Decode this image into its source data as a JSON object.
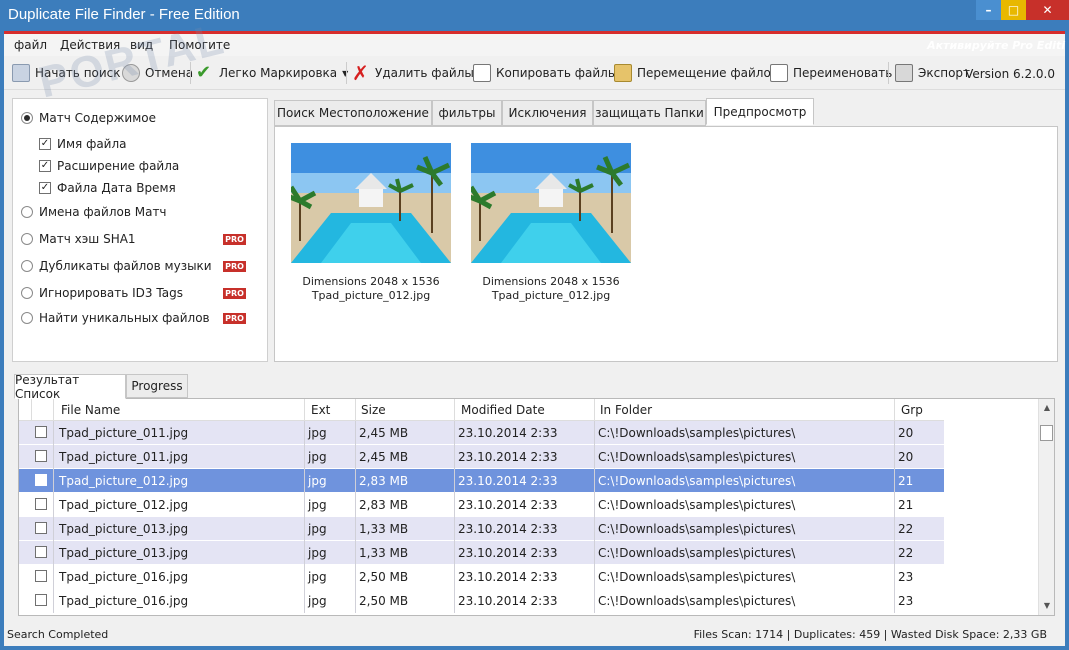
{
  "window": {
    "title": "Duplicate File Finder - Free Edition"
  },
  "menu": {
    "items": [
      "файл",
      "Действия",
      "вид",
      "Помогите"
    ],
    "activate": "Активируйте Pro Editi"
  },
  "toolbar": {
    "start": "Начать поиск",
    "cancel": "Отмена",
    "easy_mark": "Легко Маркировка",
    "delete": "Удалить файлы",
    "copy": "Копировать файлы",
    "move": "Перемещение файлов",
    "rename": "Переименовать",
    "export": "Экспорт",
    "version": "Version 6.2.0.0"
  },
  "options": {
    "match_content": "Матч Содержимое",
    "file_name": "Имя файла",
    "extension": "Расширение файла",
    "file_datetime": "Файла Дата Время",
    "match_names": "Имена файлов Матч",
    "sha1": "Матч хэш SHA1",
    "music": "Дубликаты файлов музыки",
    "id3": "Игнорировать ID3 Tags",
    "unique": "Найти уникальных файлов",
    "pro": "PRO"
  },
  "top_tabs": [
    "Поиск Местоположение",
    "фильтры",
    "Исключения",
    "защищать Папки",
    "Предпросмотр"
  ],
  "preview": [
    {
      "dim": "Dimensions 2048 x 1536",
      "name": "Tpad_picture_012.jpg"
    },
    {
      "dim": "Dimensions 2048 x 1536",
      "name": "Tpad_picture_012.jpg"
    }
  ],
  "bottom_tabs": [
    "Результат Список",
    "Progress"
  ],
  "grid": {
    "headers": [
      "File Name",
      "Ext",
      "Size",
      "Modified Date",
      "In Folder",
      "Grp"
    ],
    "rows": [
      {
        "name": "Tpad_picture_011.jpg",
        "ext": "jpg",
        "size": "2,45 MB",
        "date": "23.10.2014 2:33",
        "folder": "C:\\!Downloads\\samples\\pictures\\",
        "grp": "20"
      },
      {
        "name": "Tpad_picture_011.jpg",
        "ext": "jpg",
        "size": "2,45 MB",
        "date": "23.10.2014 2:33",
        "folder": "C:\\!Downloads\\samples\\pictures\\",
        "grp": "20"
      },
      {
        "name": "Tpad_picture_012.jpg",
        "ext": "jpg",
        "size": "2,83 MB",
        "date": "23.10.2014 2:33",
        "folder": "C:\\!Downloads\\samples\\pictures\\",
        "grp": "21"
      },
      {
        "name": "Tpad_picture_012.jpg",
        "ext": "jpg",
        "size": "2,83 MB",
        "date": "23.10.2014 2:33",
        "folder": "C:\\!Downloads\\samples\\pictures\\",
        "grp": "21"
      },
      {
        "name": "Tpad_picture_013.jpg",
        "ext": "jpg",
        "size": "1,33 MB",
        "date": "23.10.2014 2:33",
        "folder": "C:\\!Downloads\\samples\\pictures\\",
        "grp": "22"
      },
      {
        "name": "Tpad_picture_013.jpg",
        "ext": "jpg",
        "size": "1,33 MB",
        "date": "23.10.2014 2:33",
        "folder": "C:\\!Downloads\\samples\\pictures\\",
        "grp": "22"
      },
      {
        "name": "Tpad_picture_016.jpg",
        "ext": "jpg",
        "size": "2,50 MB",
        "date": "23.10.2014 2:33",
        "folder": "C:\\!Downloads\\samples\\pictures\\",
        "grp": "23"
      },
      {
        "name": "Tpad_picture_016.jpg",
        "ext": "jpg",
        "size": "2,50 MB",
        "date": "23.10.2014 2:33",
        "folder": "C:\\!Downloads\\samples\\pictures\\",
        "grp": "23"
      }
    ]
  },
  "status": {
    "left": "Search Completed",
    "right": "Files Scan: 1714 | Duplicates: 459 | Wasted Disk Space: 2,33 GB"
  },
  "watermark": "PORTAL",
  "colors": {
    "titlebar": "#3c7dbc",
    "accent_red": "#d62d2d",
    "selected_row": "#6f93dd",
    "group_row": "#e4e4f4"
  }
}
